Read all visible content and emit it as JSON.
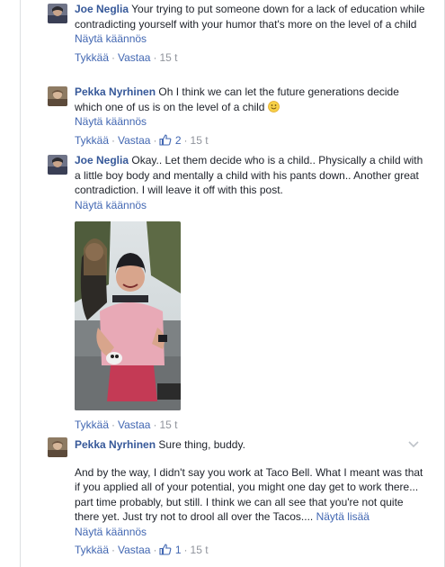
{
  "actions": {
    "like": "Tykkää",
    "reply": "Vastaa",
    "translate": "Näytä käännös",
    "see_more": "Näytä lisää",
    "separator": "·"
  },
  "comments": [
    {
      "author": "Joe Neglia",
      "text": "Your trying to put someone down for a lack of education while contradicting yourself with your humor that's more on the level of a child",
      "time": "15 t"
    },
    {
      "author": "Pekka Nyrhinen",
      "text": "Oh I think we can let the future generations decide which one of us is on the level of a child",
      "likes": "2",
      "time": "15 t"
    },
    {
      "author": "Joe Neglia",
      "text": "Okay.. Let them decide who is a child.. Physically a child with a little boy body and mentally a child with his pants down.. Another great contradiction. I will leave it off with this post.",
      "time": "15 t"
    },
    {
      "author": "Pekka Nyrhinen",
      "text": "Sure thing, buddy.",
      "text2": "And by the way, I didn't say you work at Taco Bell. What I meant was that if you applied all of your potential, you might one day get to work there... part time probably, but still. I think we can all see that you're not quite there yet. Just try not to drool all over the Tacos....",
      "likes": "1",
      "time": "15 t"
    }
  ],
  "colors": {
    "link": "#365899",
    "action": "#4267b2",
    "muted": "#90949c"
  }
}
